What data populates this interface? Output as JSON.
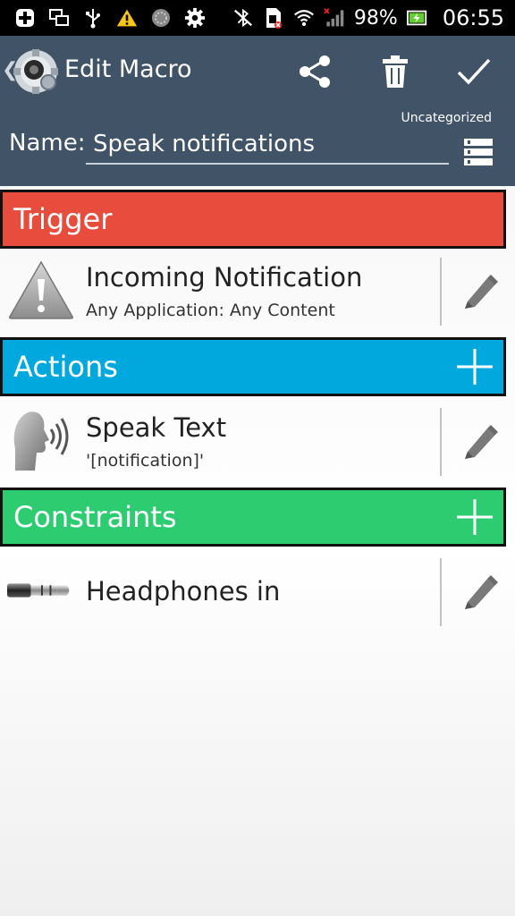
{
  "status_bar": {
    "battery_percent": "98%",
    "time": "06:55",
    "icons_left": [
      "add-square-icon",
      "screens-icon",
      "usb-icon",
      "warning-icon",
      "gear-pattern-icon",
      "settings-icon"
    ],
    "icons_right": [
      "bluetooth-off-icon",
      "sim-card-icon",
      "wifi-icon",
      "signal-icon",
      "battery-charging-icon"
    ]
  },
  "action_bar": {
    "title": "Edit Macro",
    "category": "Uncategorized",
    "name_label": "Name:",
    "name_value": "Speak notifications",
    "buttons": [
      "share-icon",
      "trash-icon",
      "checkmark-icon"
    ]
  },
  "sections": {
    "trigger": {
      "title": "Trigger",
      "color": "#e74c3c"
    },
    "actions": {
      "title": "Actions",
      "color": "#00a8de"
    },
    "constraints": {
      "title": "Constraints",
      "color": "#2ecc71"
    }
  },
  "trigger_items": [
    {
      "title": "Incoming Notification",
      "subtitle": "Any Application: Any Content",
      "icon": "warning-triangle-icon"
    }
  ],
  "action_items": [
    {
      "title": "Speak Text",
      "subtitle": "'[notification]'",
      "icon": "speaking-head-icon"
    }
  ],
  "constraint_items": [
    {
      "title": "Headphones in",
      "icon": "headphone-jack-icon"
    }
  ]
}
